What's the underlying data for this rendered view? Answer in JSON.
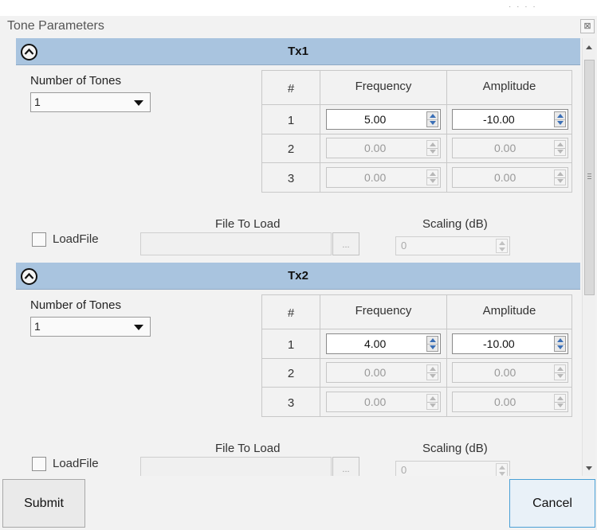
{
  "window": {
    "title": "Tone Parameters",
    "close_glyph": "⊠"
  },
  "sections": [
    {
      "title": "Tx1",
      "number_of_tones_label": "Number of Tones",
      "number_of_tones_value": "1",
      "table": {
        "headers": [
          "#",
          "Frequency",
          "Amplitude"
        ],
        "rows": [
          {
            "num": "1",
            "frequency": "5.00",
            "amplitude": "-10.00",
            "enabled": true
          },
          {
            "num": "2",
            "frequency": "0.00",
            "amplitude": "0.00",
            "enabled": false
          },
          {
            "num": "3",
            "frequency": "0.00",
            "amplitude": "0.00",
            "enabled": false
          }
        ]
      },
      "file_to_load_label": "File To Load",
      "scaling_label": "Scaling (dB)",
      "loadfile_label": "LoadFile",
      "loadfile_checked": false,
      "file_value": "",
      "browse_label": "...",
      "scaling_value": "0"
    },
    {
      "title": "Tx2",
      "number_of_tones_label": "Number of Tones",
      "number_of_tones_value": "1",
      "table": {
        "headers": [
          "#",
          "Frequency",
          "Amplitude"
        ],
        "rows": [
          {
            "num": "1",
            "frequency": "4.00",
            "amplitude": "-10.00",
            "enabled": true
          },
          {
            "num": "2",
            "frequency": "0.00",
            "amplitude": "0.00",
            "enabled": false
          },
          {
            "num": "3",
            "frequency": "0.00",
            "amplitude": "0.00",
            "enabled": false
          }
        ]
      },
      "file_to_load_label": "File To Load",
      "scaling_label": "Scaling (dB)",
      "loadfile_label": "LoadFile",
      "loadfile_checked": false,
      "file_value": "",
      "browse_label": "...",
      "scaling_value": "0"
    }
  ],
  "footer": {
    "submit_label": "Submit",
    "cancel_label": "Cancel"
  },
  "colors": {
    "section_header": "#a9c4df",
    "panel_bg": "#f2f2f2",
    "spin_arrow": "#3b6fb6",
    "cancel_focus_border": "#4aa0d6"
  },
  "icons": {
    "collapse": "chevron-up-circle-icon",
    "close": "close-icon",
    "dropdown": "caret-down-icon"
  }
}
